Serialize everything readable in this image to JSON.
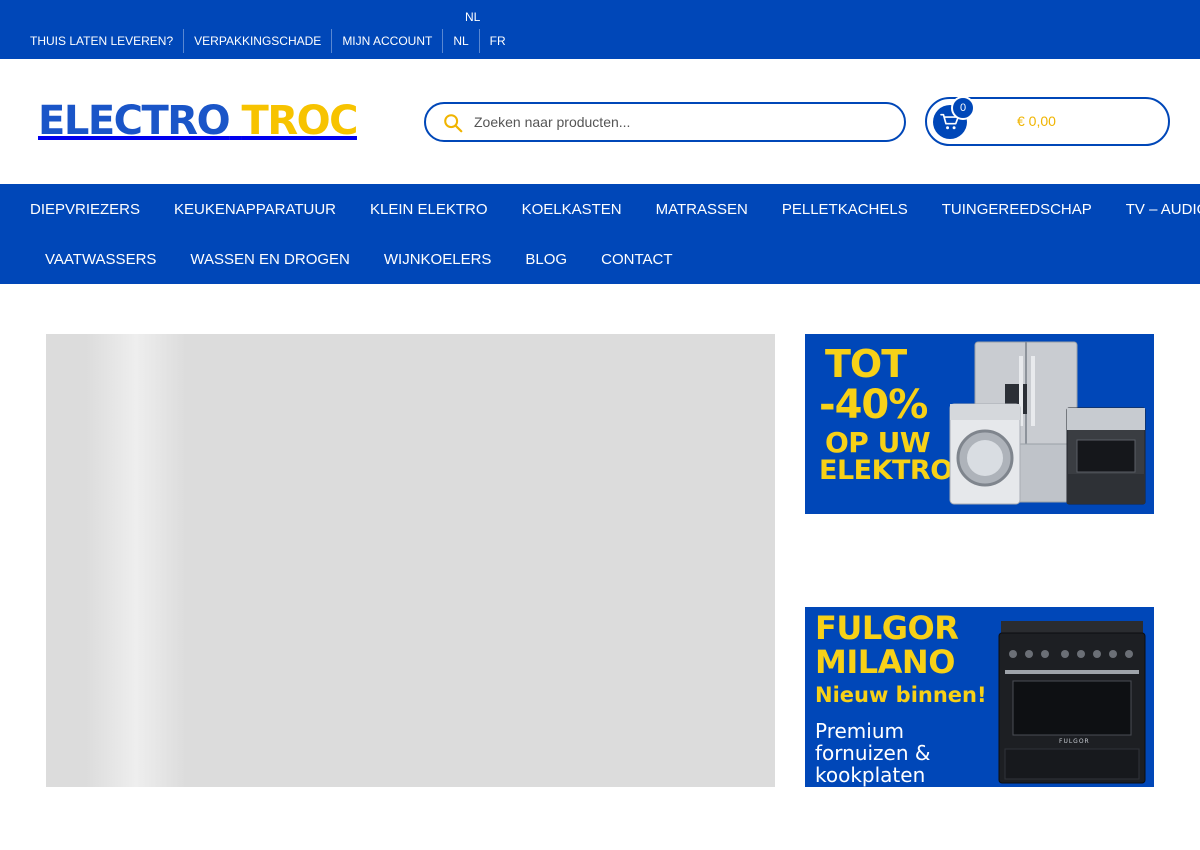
{
  "topbar": {
    "lang_current": "NL",
    "links": [
      "THUIS LATEN LEVEREN?",
      "VERPAKKINGSCHADE",
      "MIJN ACCOUNT",
      "NL",
      "FR"
    ]
  },
  "header": {
    "logo_part1": "ELECTRO",
    "logo_part2": "TROC",
    "search_placeholder": "Zoeken naar producten...",
    "cart_count": "0",
    "cart_total": "€ 0,00"
  },
  "nav": {
    "row1": [
      "DIEPVRIEZERS",
      "KEUKENAPPARATUUR",
      "KLEIN ELEKTRO",
      "KOELKASTEN",
      "MATRASSEN",
      "PELLETKACHELS",
      "TUINGEREEDSCHAP",
      "TV – AUDIO"
    ],
    "row2": [
      "VAATWASSERS",
      "WASSEN EN DROGEN",
      "WIJNKOELERS",
      "BLOG",
      "CONTACT"
    ]
  },
  "banners": {
    "promo": {
      "line1": "TOT",
      "line2": "-40%",
      "line3": "OP UW",
      "line4": "ELEKTRO"
    },
    "fulgor": {
      "line1": "FULGOR",
      "line2": "MILANO",
      "line3": "Nieuw binnen!",
      "line4a": "Premium",
      "line4b": "fornuizen &",
      "line4c": "kookplaten",
      "brand": "FULGOR"
    }
  },
  "colors": {
    "primary": "#0047b8",
    "accent": "#f7c300"
  },
  "icons": {
    "search": "search-icon",
    "cart": "cart-icon"
  }
}
